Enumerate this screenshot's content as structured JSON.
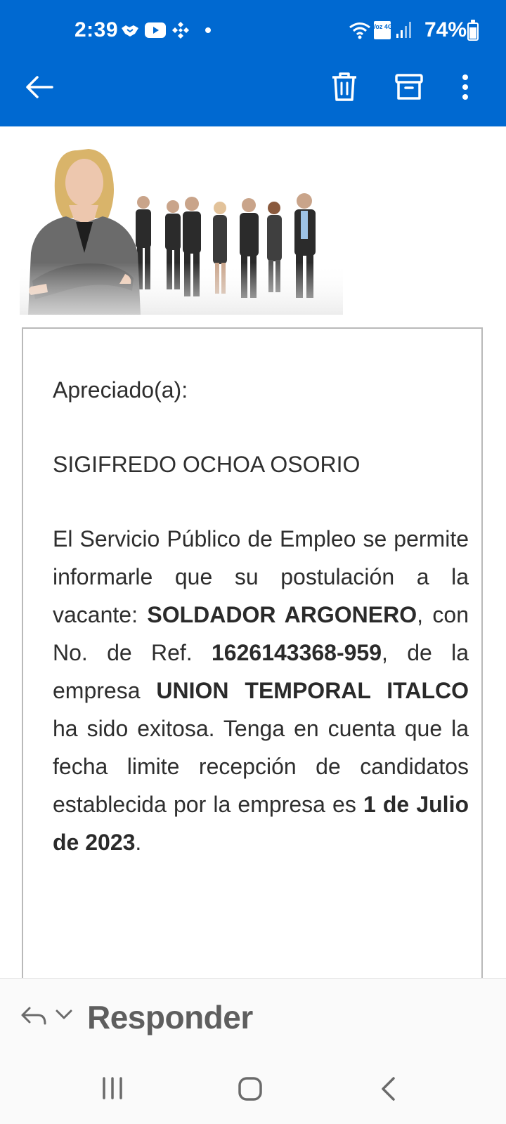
{
  "status_bar": {
    "time": "2:39",
    "network_label": "Voz 4G",
    "battery": "74%",
    "battery_level": 0.74
  },
  "app_bar": {
    "back_icon": "arrow-left-icon",
    "delete_icon": "trash-icon",
    "archive_icon": "archive-icon",
    "more_icon": "more-vertical-icon"
  },
  "email": {
    "greeting": "Apreciado(a):",
    "recipient": "SIGIFREDO OCHOA OSORIO",
    "body": {
      "p1": "El Servicio Público de Empleo se permite informarle que su postulación a la vacante: ",
      "vacancy": "SOLDADOR ARGONERO",
      "p2": ", con No. de Ref. ",
      "ref": "1626143368-959",
      "p3": ", de la empresa ",
      "company": "UNION TEMPORAL ITALCO",
      "p4": " ha sido exitosa. Tenga en cuenta que la fecha limite recepción de candidatos establecida por la empresa es ",
      "deadline": "1 de Julio de 2023",
      "p5": "."
    }
  },
  "reply_bar": {
    "label": "Responder"
  },
  "colors": {
    "header": "#0069d1",
    "text": "#2e2e2e",
    "reply_text": "#5e5e5e"
  }
}
